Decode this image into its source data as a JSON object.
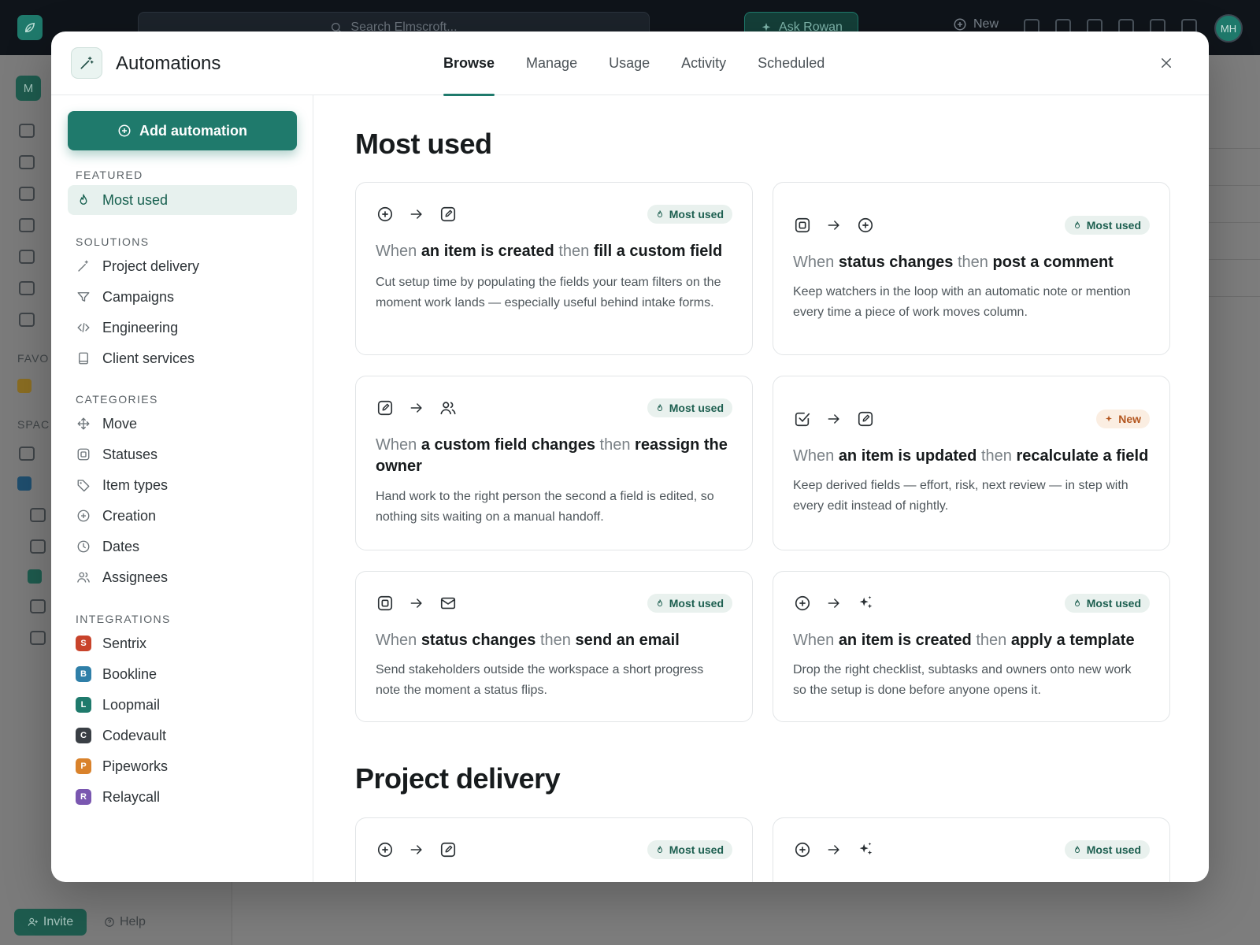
{
  "background": {
    "search_placeholder": "Search Elmscroft...",
    "ask_label": "Ask Rowan",
    "new_label": "New",
    "avatar_initials": "MH",
    "workspace_initial": "M",
    "favorites_label": "FAVO",
    "spaces_label": "SPAC",
    "invite_label": "Invite",
    "help_label": "Help"
  },
  "modal": {
    "title": "Automations",
    "tabs": [
      {
        "label": "Browse",
        "active": true
      },
      {
        "label": "Manage",
        "active": false
      },
      {
        "label": "Usage",
        "active": false
      },
      {
        "label": "Activity",
        "active": false
      },
      {
        "label": "Scheduled",
        "active": false
      }
    ]
  },
  "sidebar": {
    "add_button": "Add automation",
    "featured_label": "FEATURED",
    "featured": [
      {
        "label": "Most used",
        "icon": "flame-icon"
      }
    ],
    "solutions_label": "SOLUTIONS",
    "solutions": [
      {
        "label": "Project delivery",
        "icon": "wand-icon"
      },
      {
        "label": "Campaigns",
        "icon": "filter-icon"
      },
      {
        "label": "Engineering",
        "icon": "code-icon"
      },
      {
        "label": "Client services",
        "icon": "book-icon"
      }
    ],
    "categories_label": "CATEGORIES",
    "categories": [
      {
        "label": "Move",
        "icon": "move-icon"
      },
      {
        "label": "Statuses",
        "icon": "status-icon"
      },
      {
        "label": "Item types",
        "icon": "tag-icon"
      },
      {
        "label": "Creation",
        "icon": "plus-circle-icon"
      },
      {
        "label": "Dates",
        "icon": "clock-icon"
      },
      {
        "label": "Assignees",
        "icon": "users-icon"
      }
    ],
    "integrations_label": "INTEGRATIONS",
    "integrations": [
      {
        "label": "Sentrix",
        "letter": "S",
        "color": "#c8432b"
      },
      {
        "label": "Bookline",
        "letter": "B",
        "color": "#2f7fa8"
      },
      {
        "label": "Loopmail",
        "letter": "L",
        "color": "#1f7a6c"
      },
      {
        "label": "Codevault",
        "letter": "C",
        "color": "#3a3f45"
      },
      {
        "label": "Pipeworks",
        "letter": "P",
        "color": "#d9822b"
      },
      {
        "label": "Relaycall",
        "letter": "R",
        "color": "#7a57b0"
      }
    ]
  },
  "sections": [
    {
      "heading": "Most used",
      "cards": [
        {
          "trigger_icon": "plus-circle-icon",
          "action_icon": "edit-icon",
          "badge": "Most used",
          "badge_type": "most-used",
          "when": "When",
          "trigger": "an item is created",
          "then": "then",
          "action": "fill a custom field",
          "description": "Cut setup time by populating the fields your team filters on the moment work lands — especially useful behind intake forms."
        },
        {
          "trigger_icon": "status-icon",
          "action_icon": "plus-circle-icon",
          "badge": "Most used",
          "badge_type": "most-used",
          "when": "When",
          "trigger": "status changes",
          "then": "then",
          "action": "post a comment",
          "description": "Keep watchers in the loop with an automatic note or mention every time a piece of work moves column."
        },
        {
          "trigger_icon": "edit-icon",
          "action_icon": "users-icon",
          "badge": "Most used",
          "badge_type": "most-used",
          "when": "When",
          "trigger": "a custom field changes",
          "then": "then",
          "action": "reassign the owner",
          "description": "Hand work to the right person the second a field is edited, so nothing sits waiting on a manual handoff."
        },
        {
          "trigger_icon": "checkbox-icon",
          "action_icon": "edit-icon",
          "badge": "New",
          "badge_type": "new",
          "when": "When",
          "trigger": "an item is updated",
          "then": "then",
          "action": "recalculate a field",
          "description": "Keep derived fields — effort, risk, next review — in step with every edit instead of nightly."
        },
        {
          "trigger_icon": "status-icon",
          "action_icon": "mail-icon",
          "badge": "Most used",
          "badge_type": "most-used",
          "when": "When",
          "trigger": "status changes",
          "then": "then",
          "action": "send an email",
          "description": "Send stakeholders outside the workspace a short progress note the moment a status flips."
        },
        {
          "trigger_icon": "plus-circle-icon",
          "action_icon": "sparkles-icon",
          "badge": "Most used",
          "badge_type": "most-used",
          "when": "When",
          "trigger": "an item is created",
          "then": "then",
          "action": "apply a template",
          "description": "Drop the right checklist, subtasks and owners onto new work so the setup is done before anyone opens it."
        }
      ]
    },
    {
      "heading": "Project delivery",
      "cards": [
        {
          "trigger_icon": "plus-circle-icon",
          "action_icon": "edit-icon",
          "badge": "Most used",
          "badge_type": "most-used"
        },
        {
          "trigger_icon": "plus-circle-icon",
          "action_icon": "sparkles-icon",
          "badge": "Most used",
          "badge_type": "most-used"
        }
      ]
    }
  ]
}
